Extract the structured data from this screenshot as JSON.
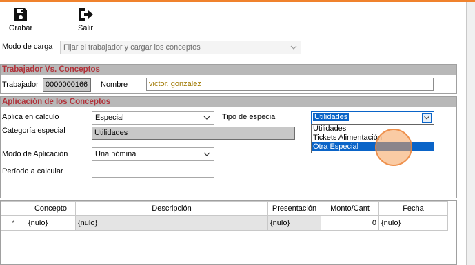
{
  "toolbar": {
    "save_label": "Grabar",
    "exit_label": "Salir"
  },
  "load_mode": {
    "label": "Modo de carga",
    "value": "Fijar el trabajador y cargar los conceptos"
  },
  "worker_section": {
    "title": "Trabajador Vs. Conceptos",
    "worker_label": "Trabajador",
    "worker_code": "0000000166",
    "name_label": "Nombre",
    "name_value": "victor, gonzalez"
  },
  "concepts_section": {
    "title": "Aplicación de los Conceptos",
    "applies_label": "Aplica en cálculo",
    "applies_value": "Especial",
    "special_type_label": "Tipo de especial",
    "special_type_value": "Utilidades",
    "special_category_label": "Categoría especial",
    "special_category_value": "Utilidades",
    "application_mode_label": "Modo de Aplicación",
    "application_mode_value": "Una nómina",
    "period_label": "Período a calcular",
    "period_value": ""
  },
  "special_type_dropdown": {
    "options": [
      "Utilidades",
      "Tickets Alimentación",
      "Otra Especial"
    ],
    "highlighted": "Otra Especial"
  },
  "grid": {
    "columns": [
      "Concepto",
      "Descripción",
      "Presentación",
      "Monto/Cant",
      "Fecha"
    ],
    "new_row_marker": "*",
    "rows": [
      {
        "concepto": "{nulo}",
        "descripcion": "{nulo}",
        "presentacion": "{nulo}",
        "monto": "0",
        "fecha": "{nulo}"
      }
    ]
  },
  "colors": {
    "accent_orange": "#f0822d",
    "section_title_red": "#b1323a",
    "section_header_gray": "#b8b8b8",
    "code_field_gray": "#c8c8c8",
    "highlight_yellow": "#a07800",
    "selection_blue": "#0a64c8"
  }
}
